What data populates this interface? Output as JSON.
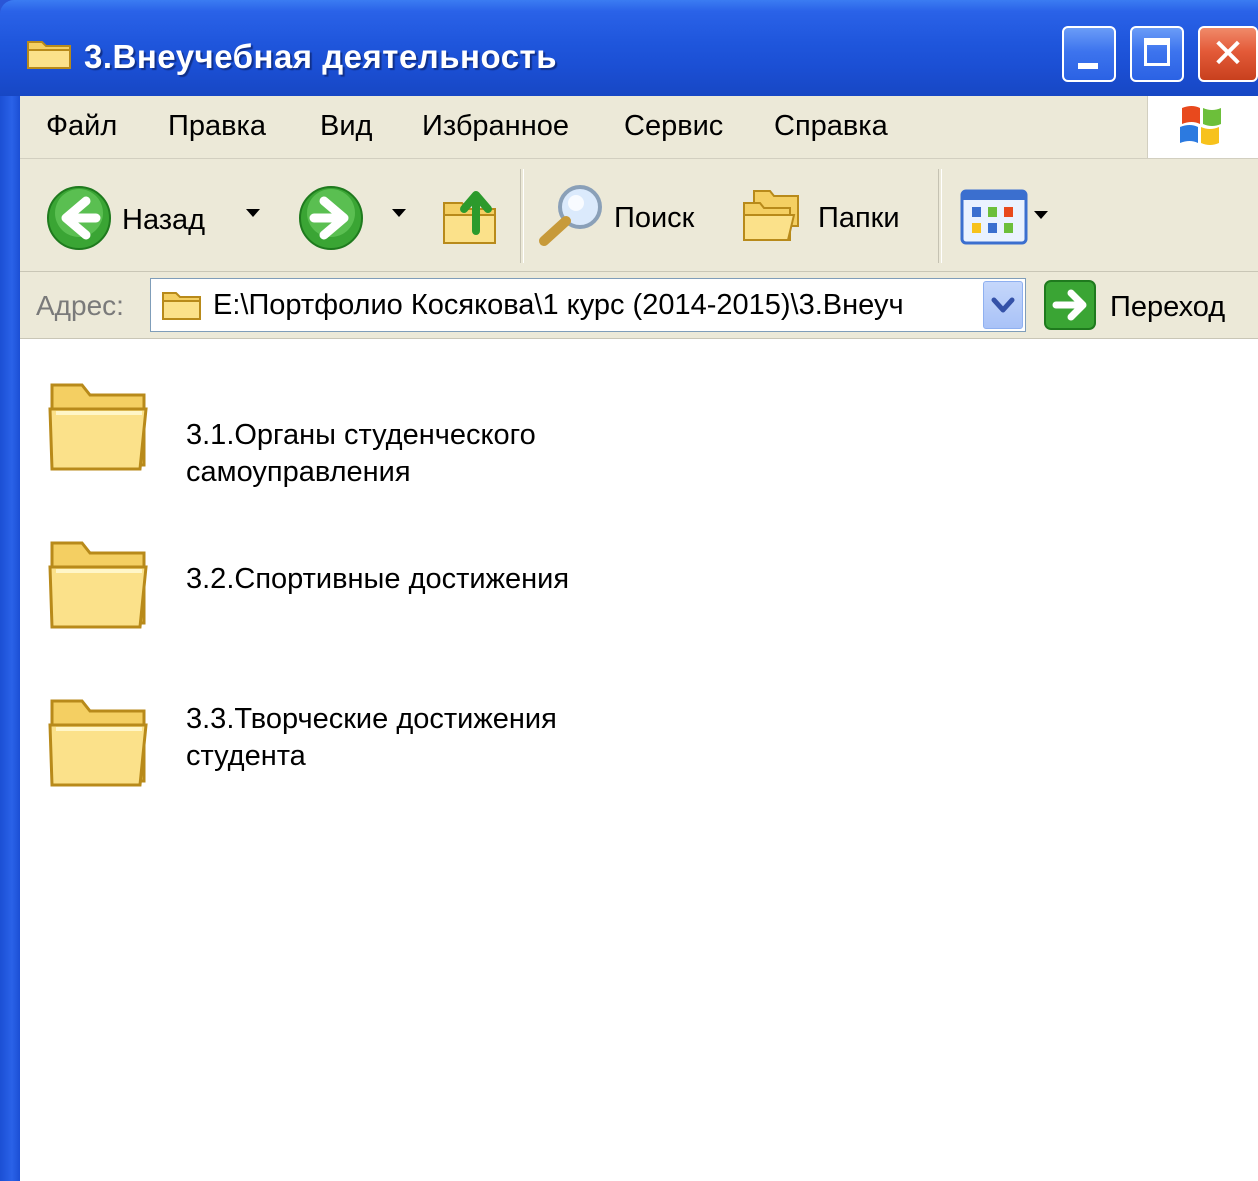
{
  "window": {
    "title": "3.Внеучебная деятельность",
    "buttons": {
      "minimize": "minimize",
      "maximize": "maximize",
      "close": "✕"
    }
  },
  "menu": {
    "items": [
      "Файл",
      "Правка",
      "Вид",
      "Избранное",
      "Сервис",
      "Справка"
    ]
  },
  "toolbar": {
    "back_label": "Назад",
    "search_label": "Поиск",
    "folders_label": "Папки"
  },
  "address": {
    "label": "Адрес:",
    "value": "E:\\Портфолио Косякова\\1 курс (2014-2015)\\3.Внеуч",
    "go_label": "Переход"
  },
  "files": [
    {
      "name_line1": "3.1.Органы студенческого",
      "name_line2": "самоуправления"
    },
    {
      "name_line1": "3.2.Спортивные достижения",
      "name_line2": ""
    },
    {
      "name_line1": "3.3.Творческие достижения",
      "name_line2": "студента"
    }
  ],
  "colors": {
    "titlebar": "#1f56dc",
    "chrome": "#ece9d8",
    "folder": "#f7d56a"
  }
}
